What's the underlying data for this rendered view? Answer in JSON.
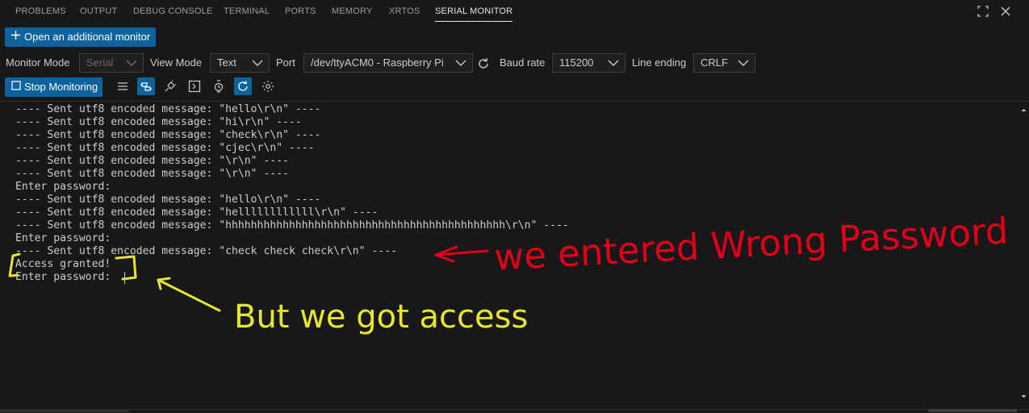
{
  "tabs": [
    "PROBLEMS",
    "OUTPUT",
    "DEBUG CONSOLE",
    "TERMINAL",
    "PORTS",
    "MEMORY",
    "XRTOS",
    "SERIAL MONITOR"
  ],
  "active_tab": "SERIAL MONITOR",
  "actions": {
    "open_monitor": "Open an additional monitor",
    "stop_monitoring": "Stop Monitoring"
  },
  "settings": {
    "monitor_mode_label": "Monitor Mode",
    "monitor_mode_value": "Serial",
    "view_mode_label": "View Mode",
    "view_mode_value": "Text",
    "port_label": "Port",
    "port_value": "/dev/ttyACM0 - Raspberry Pi",
    "baud_label": "Baud rate",
    "baud_value": "115200",
    "line_ending_label": "Line ending",
    "line_ending_value": "CRLF"
  },
  "console_lines": [
    "---- Sent utf8 encoded message: \"hello\\r\\n\" ----",
    "---- Sent utf8 encoded message: \"hi\\r\\n\" ----",
    "---- Sent utf8 encoded message: \"check\\r\\n\" ----",
    "---- Sent utf8 encoded message: \"cjec\\r\\n\" ----",
    "---- Sent utf8 encoded message: \"\\r\\n\" ----",
    "---- Sent utf8 encoded message: \"\\r\\n\" ----",
    "Enter password:",
    "---- Sent utf8 encoded message: \"hello\\r\\n\" ----",
    "---- Sent utf8 encoded message: \"hellllllllllll\\r\\n\" ----",
    "---- Sent utf8 encoded message: \"hhhhhhhhhhhhhhhhhhhhhhhhhhhhhhhhhhhhhhhhhhhh\\r\\n\" ----",
    "Enter password:",
    "---- Sent utf8 encoded message: \"check check check\\r\\n\" ----",
    "Access granted!",
    "Enter password: "
  ],
  "annotations": {
    "red": "we entered Wrong Password",
    "yellow": "But we got access"
  },
  "colors": {
    "accent": "#0e639c",
    "red_annotation": "#e0001b",
    "yellow_annotation": "#e6e62e"
  },
  "icons": [
    "plus-icon",
    "maximize-icon",
    "close-icon",
    "chevron-down-icon",
    "refresh-icon",
    "checkbox-icon",
    "wrap-icon",
    "connect-icon",
    "plug-icon",
    "terminal-icon",
    "timestamp-icon",
    "autoscroll-icon",
    "settings-gear-icon"
  ]
}
